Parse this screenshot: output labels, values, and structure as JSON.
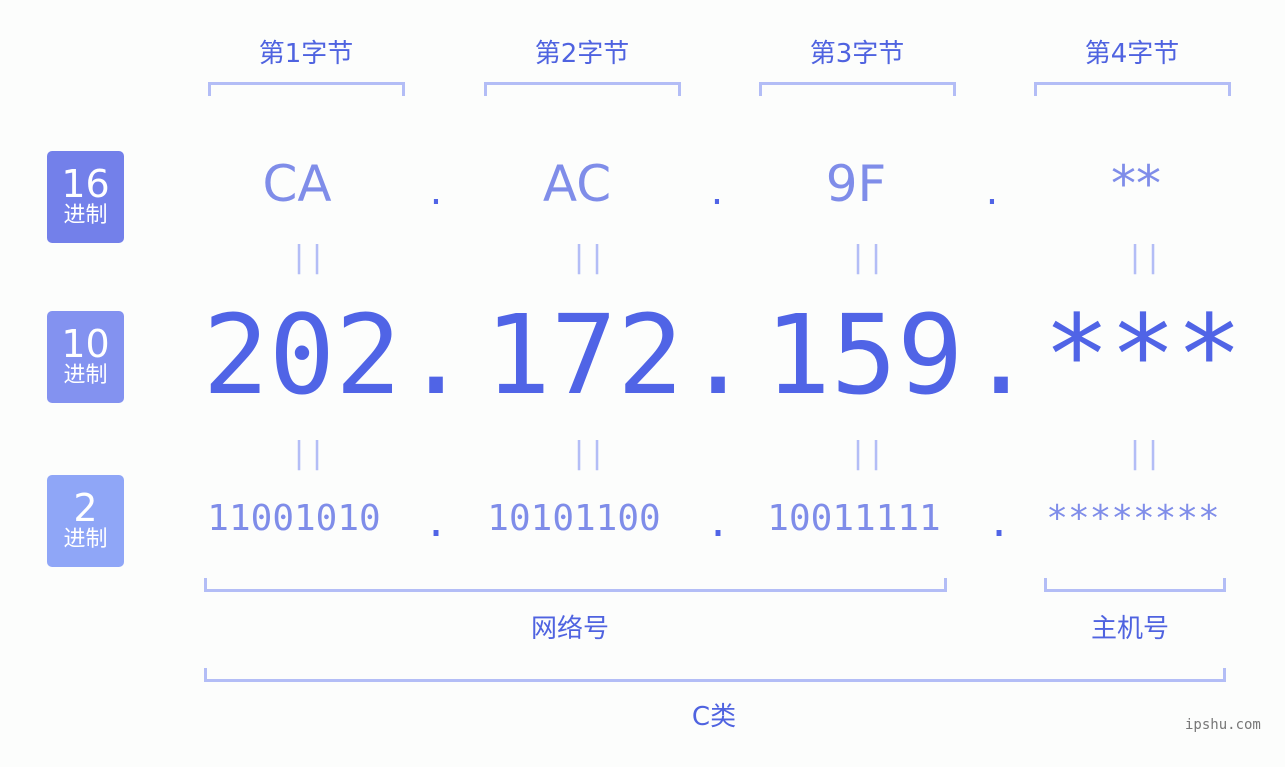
{
  "bytes": [
    {
      "label": "第1字节",
      "hex": "CA",
      "dec": "202",
      "bin": "11001010"
    },
    {
      "label": "第2字节",
      "hex": "AC",
      "dec": "172",
      "bin": "10101100"
    },
    {
      "label": "第3字节",
      "hex": "9F",
      "dec": "159",
      "bin": "10011111"
    },
    {
      "label": "第4字节",
      "hex": "**",
      "dec": "***",
      "bin": "********"
    }
  ],
  "separator": ".",
  "equals": "||",
  "bases": [
    {
      "num": "16",
      "unit": "进制",
      "color": "#7380ea"
    },
    {
      "num": "10",
      "unit": "进制",
      "color": "#8392f0"
    },
    {
      "num": "2",
      "unit": "进制",
      "color": "#8fa6f7"
    }
  ],
  "groups": {
    "network": "网络号",
    "host": "主机号",
    "class": "C类"
  },
  "watermark": "ipshu.com",
  "colors": {
    "accent": "#5064e6",
    "light": "#7f8de9",
    "bracket": "#b3bdf6"
  }
}
